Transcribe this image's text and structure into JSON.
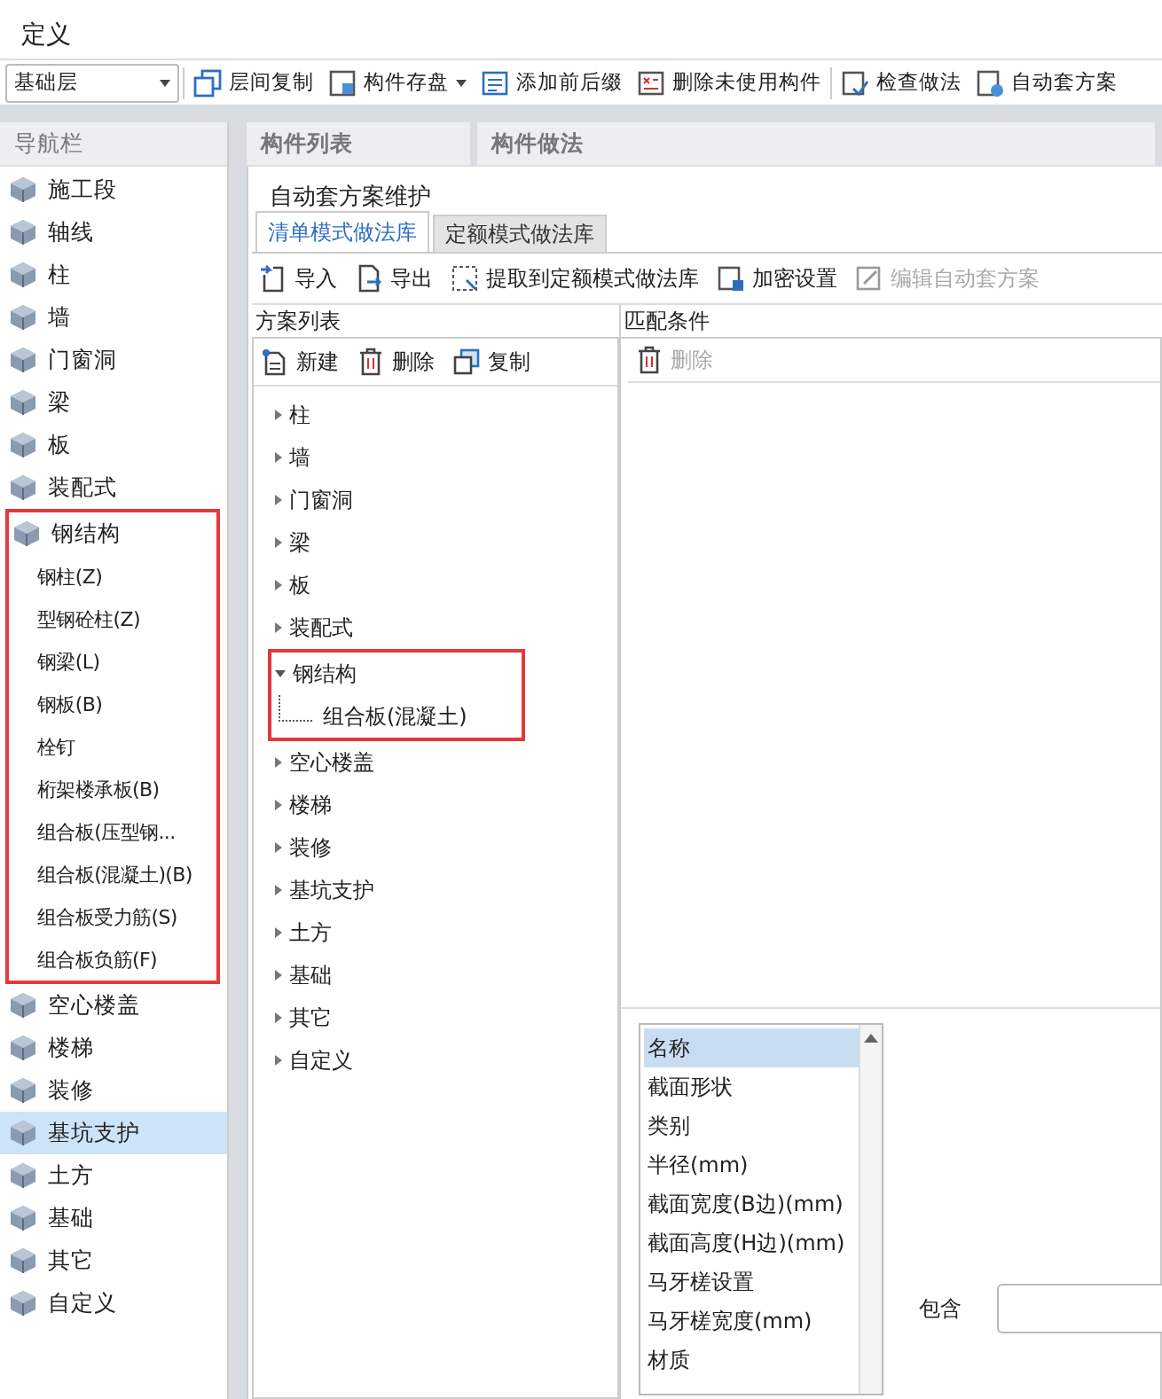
{
  "window": {
    "title": "定义"
  },
  "toolbar": {
    "floor_select": {
      "value": "基础层"
    },
    "button_groups": [
      [
        {
          "label": "层间复制",
          "has_menu": false
        },
        {
          "label": "构件存盘",
          "has_menu": true
        },
        {
          "label": "添加前后缀",
          "has_menu": false
        },
        {
          "label": "删除未使用构件",
          "has_menu": false
        }
      ],
      [
        {
          "label": "检查做法",
          "has_menu": false
        },
        {
          "label": "自动套方案",
          "has_menu": false
        }
      ]
    ]
  },
  "panel_headers": [
    "导航栏",
    "构件列表",
    "构件做法"
  ],
  "sidebar": {
    "items": [
      {
        "label": "施工段",
        "selected": false,
        "outlined": false
      },
      {
        "label": "轴线",
        "selected": false,
        "outlined": false
      },
      {
        "label": "柱",
        "selected": false,
        "outlined": false
      },
      {
        "label": "墙",
        "selected": false,
        "outlined": false
      },
      {
        "label": "门窗洞",
        "selected": false,
        "outlined": false
      },
      {
        "label": "梁",
        "selected": false,
        "outlined": false
      },
      {
        "label": "板",
        "selected": false,
        "outlined": false
      },
      {
        "label": "装配式",
        "selected": false,
        "outlined": false
      },
      {
        "label": "钢结构",
        "selected": false,
        "outlined": true,
        "children": [
          {
            "label": "钢柱(Z)",
            "selected": false
          },
          {
            "label": "型钢砼柱(Z)",
            "selected": false
          },
          {
            "label": "钢梁(L)",
            "selected": false
          },
          {
            "label": "钢板(B)",
            "selected": false
          },
          {
            "label": "栓钉",
            "selected": false
          },
          {
            "label": "桁架楼承板(B)",
            "selected": false
          },
          {
            "label": "组合板(压型钢...",
            "selected": false
          },
          {
            "label": "组合板(混凝土)(B)",
            "selected": false
          },
          {
            "label": "组合板受力筋(S)",
            "selected": false
          },
          {
            "label": "组合板负筋(F)",
            "selected": false
          }
        ]
      },
      {
        "label": "空心楼盖",
        "selected": false,
        "outlined": false
      },
      {
        "label": "楼梯",
        "selected": false,
        "outlined": false
      },
      {
        "label": "装修",
        "selected": false,
        "outlined": false
      },
      {
        "label": "基坑支护",
        "selected": true,
        "outlined": false
      },
      {
        "label": "土方",
        "selected": false,
        "outlined": false
      },
      {
        "label": "基础",
        "selected": false,
        "outlined": false
      },
      {
        "label": "其它",
        "selected": false,
        "outlined": false
      },
      {
        "label": "自定义",
        "selected": false,
        "outlined": false
      }
    ]
  },
  "dialog": {
    "title": "自动套方案维护",
    "tabs": [
      {
        "label": "清单模式做法库",
        "selected": true
      },
      {
        "label": "定额模式做法库",
        "selected": false
      }
    ],
    "actions": [
      {
        "label": "导入",
        "disabled": false
      },
      {
        "label": "导出",
        "disabled": false
      },
      {
        "label": "提取到定额模式做法库",
        "disabled": false
      },
      {
        "label": "加密设置",
        "disabled": false
      },
      {
        "label": "编辑自动套方案",
        "disabled": true
      }
    ],
    "scheme_list": {
      "title": "方案列表",
      "actions": [
        {
          "label": "新建",
          "disabled": false
        },
        {
          "label": "删除",
          "disabled": false
        },
        {
          "label": "复制",
          "disabled": false
        }
      ],
      "tree": [
        {
          "label": "柱",
          "expanded": false,
          "outlined": false
        },
        {
          "label": "墙",
          "expanded": false,
          "outlined": false
        },
        {
          "label": "门窗洞",
          "expanded": false,
          "outlined": false
        },
        {
          "label": "梁",
          "expanded": false,
          "outlined": false
        },
        {
          "label": "板",
          "expanded": false,
          "outlined": false
        },
        {
          "label": "装配式",
          "expanded": false,
          "outlined": false
        },
        {
          "label": "钢结构",
          "expanded": true,
          "outlined": true,
          "children": [
            {
              "label": "组合板(混凝土)"
            }
          ]
        },
        {
          "label": "空心楼盖",
          "expanded": false,
          "outlined": false
        },
        {
          "label": "楼梯",
          "expanded": false,
          "outlined": false
        },
        {
          "label": "装修",
          "expanded": false,
          "outlined": false
        },
        {
          "label": "基坑支护",
          "expanded": false,
          "outlined": false
        },
        {
          "label": "土方",
          "expanded": false,
          "outlined": false
        },
        {
          "label": "基础",
          "expanded": false,
          "outlined": false
        },
        {
          "label": "其它",
          "expanded": false,
          "outlined": false
        },
        {
          "label": "自定义",
          "expanded": false,
          "outlined": false
        }
      ]
    },
    "match_conditions": {
      "title": "匹配条件",
      "actions": [
        {
          "label": "删除",
          "disabled": true
        }
      ],
      "attributes": [
        {
          "label": "名称",
          "selected": true
        },
        {
          "label": "截面形状",
          "selected": false
        },
        {
          "label": "类别",
          "selected": false
        },
        {
          "label": "半径(mm)",
          "selected": false
        },
        {
          "label": "截面宽度(B边)(mm)",
          "selected": false
        },
        {
          "label": "截面高度(H边)(mm)",
          "selected": false
        },
        {
          "label": "马牙槎设置",
          "selected": false
        },
        {
          "label": "马牙槎宽度(mm)",
          "selected": false
        },
        {
          "label": "材质",
          "selected": false
        }
      ],
      "contains_label": "包含"
    }
  }
}
